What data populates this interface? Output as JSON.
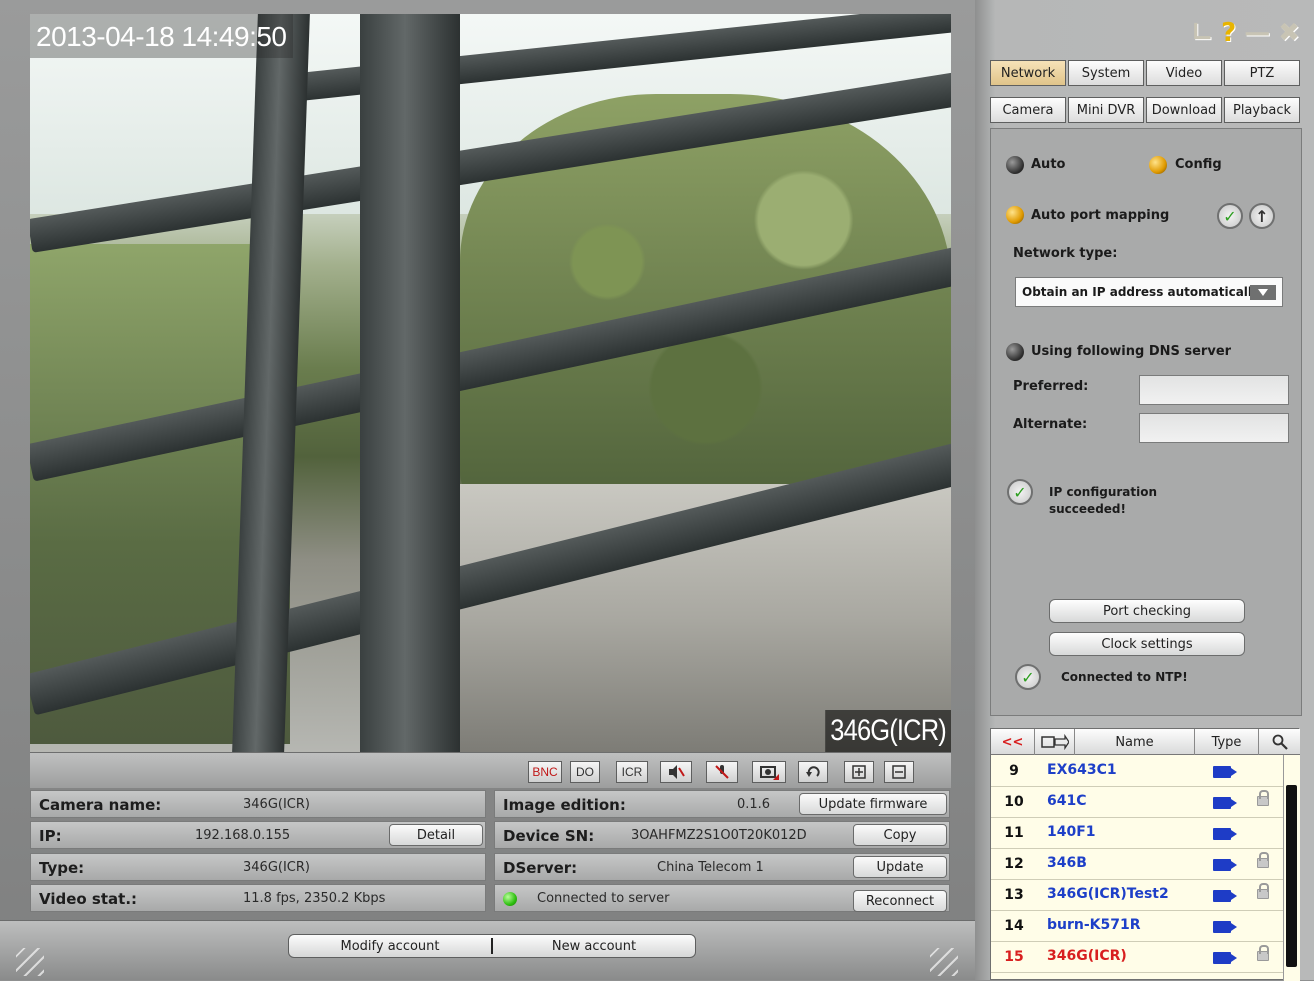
{
  "video": {
    "timestamp": "2013-04-18 14:49:50",
    "camera_overlay": "346G(ICR)"
  },
  "controls": {
    "bnc": "BNC",
    "do": "DO",
    "icr": "ICR",
    "mute_icon": "speaker-mute-icon",
    "mic_icon": "mic-off-icon",
    "snapshot_icon": "snapshot-icon",
    "rotate_icon": "rotate-icon",
    "zoom_in_icon": "zoom-in-icon",
    "zoom_out_icon": "zoom-out-icon"
  },
  "info": {
    "camera_name_label": "Camera name:",
    "camera_name_value": "346G(ICR)",
    "ip_label": "IP:",
    "ip_value": "192.168.0.155",
    "detail_button": "Detail",
    "type_label": "Type:",
    "type_value": "346G(ICR)",
    "video_stat_label": "Video stat.:",
    "video_stat_value": "11.8 fps, 2350.2 Kbps",
    "image_edition_label": "Image edition:",
    "image_edition_value": "0.1.6",
    "update_firmware_button": "Update firmware",
    "device_sn_label": "Device SN:",
    "device_sn_value": "3OAHFMZ2S1O0T20K012D",
    "copy_button": "Copy",
    "dserver_label": "DServer:",
    "dserver_value": "China Telecom 1",
    "update_button": "Update",
    "connection_status": "Connected to server",
    "reconnect_button": "Reconnect"
  },
  "account": {
    "modify": "Modify account",
    "new": "New account"
  },
  "window": {
    "layout_icon": "layout-icon",
    "help_icon": "help-icon",
    "minimize_icon": "minimize-icon",
    "close_icon": "close-icon"
  },
  "tabs_row1": [
    "Network",
    "System",
    "Video",
    "PTZ"
  ],
  "tabs_row2": [
    "Camera",
    "Mini DVR",
    "Download",
    "Playback"
  ],
  "network": {
    "auto_label": "Auto",
    "config_label": "Config",
    "auto_port_mapping_label": "Auto port mapping",
    "network_type_label": "Network type:",
    "network_type_value": "Obtain an IP address automatically",
    "dns_label": "Using following DNS server",
    "preferred_label": "Preferred:",
    "alternate_label": "Alternate:",
    "ip_config_status": "IP configuration succeeded",
    "port_checking_button": "Port checking",
    "clock_settings_button": "Clock settings",
    "ntp_status": "Connected to NTP"
  },
  "device_list": {
    "back_label": "<<",
    "col_name": "Name",
    "col_type": "Type",
    "rows": [
      {
        "num": "9",
        "name": "EX643C1",
        "locked": false
      },
      {
        "num": "10",
        "name": "641C",
        "locked": true
      },
      {
        "num": "11",
        "name": "140F1",
        "locked": false
      },
      {
        "num": "12",
        "name": "346B",
        "locked": true
      },
      {
        "num": "13",
        "name": "346G(ICR)Test2",
        "locked": true
      },
      {
        "num": "14",
        "name": "burn-K571R",
        "locked": false
      },
      {
        "num": "15",
        "name": "346G(ICR)",
        "locked": true,
        "selected": true
      }
    ]
  },
  "colors": {
    "link_blue": "#1d3fc8",
    "selected_red": "#d81f1f",
    "active_tab": "#e0c48a",
    "status_green": "#2ebf10"
  }
}
